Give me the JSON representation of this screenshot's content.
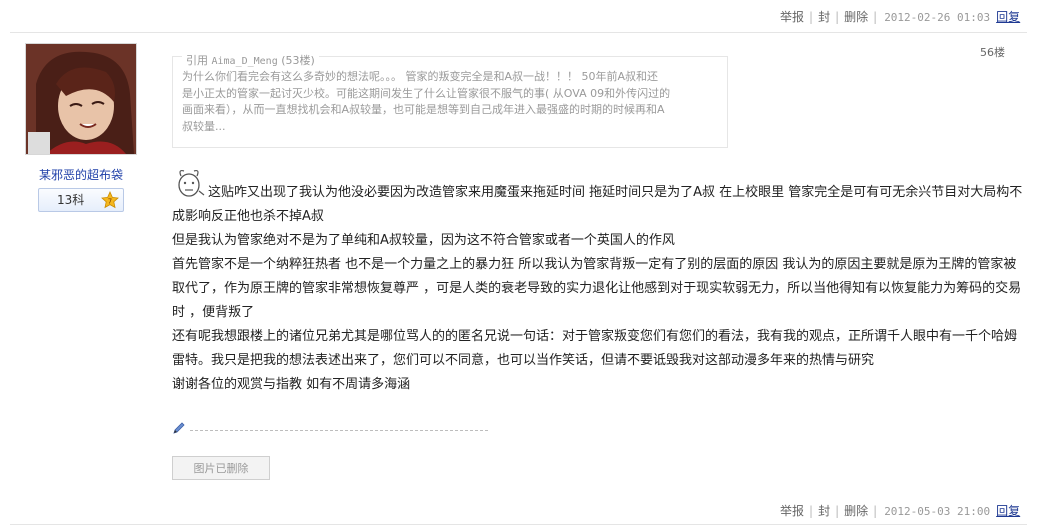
{
  "top_bar": {
    "report": "举报",
    "ban": "封",
    "delete": "删除",
    "time": "2012-02-26 01:03",
    "reply": "回复"
  },
  "author": {
    "name": "某邪恶的超布袋",
    "level": "13科",
    "level_badge": "7"
  },
  "post": {
    "floor": "56楼",
    "quote": {
      "label": "引用",
      "name": "Aima_D_Meng",
      "floor": "(53楼)",
      "lines": [
        "为什么你们看完会有这么多奇妙的想法呢。。。 管家的叛变完全是和A叔一战！！！ 50年前A叔和还",
        "是小正太的管家一起讨灭少校。可能这期间发生了什么让管家很不服气的事( 从OVA 09和外传闪过的",
        "画面来看），从而一直想找机会和A叔较量，也可能是想等到自己成年进入最强盛的时期的时候再和A",
        "叔较量..."
      ]
    },
    "paragraphs": [
      "这贴咋又出现了我认为他没必要因为改造管家来用魔蛋来拖延时间 拖延时间只是为了A叔 在上校眼里 管家完全是可有可无余兴节目对大局构不成影响反正他也杀不掉A叔",
      "但是我认为管家绝对不是为了单纯和A叔较量，因为这不符合管家或者一个英国人的作风",
      "首先管家不是一个纳粹狂热者  也不是一个力量之上的暴力狂 所以我认为管家背叛一定有了别的层面的原因 我认为的原因主要就是原为王牌的管家被取代了，作为原王牌的管家非常想恢复尊严 ，可是人类的衰老导致的实力退化让他感到对于现实软弱无力，所以当他得知有以恢复能力为筹码的交易时 ，便背叛了",
      "还有呢我想跟楼上的诸位兄弟尤其是哪位骂人的的匿名兄说一句话：对于管家叛变您们有您们的看法，我有我的观点，正所谓千人眼中有一千个哈姆雷特。我只是把我的想法表述出来了，您们可以不同意，也可以当作笑话，但请不要诋毁我对这部动漫多年来的热情与研究",
      "谢谢各位的观赏与指教  如有不周请多海涵"
    ],
    "image_deleted_label": "图片已删除"
  },
  "bottom_bar": {
    "report": "举报",
    "ban": "封",
    "delete": "删除",
    "time": "2012-05-03 21:00",
    "reply": "回复"
  },
  "colors": {
    "link_blue": "#1e3fa8",
    "muted_gray": "#999999"
  }
}
